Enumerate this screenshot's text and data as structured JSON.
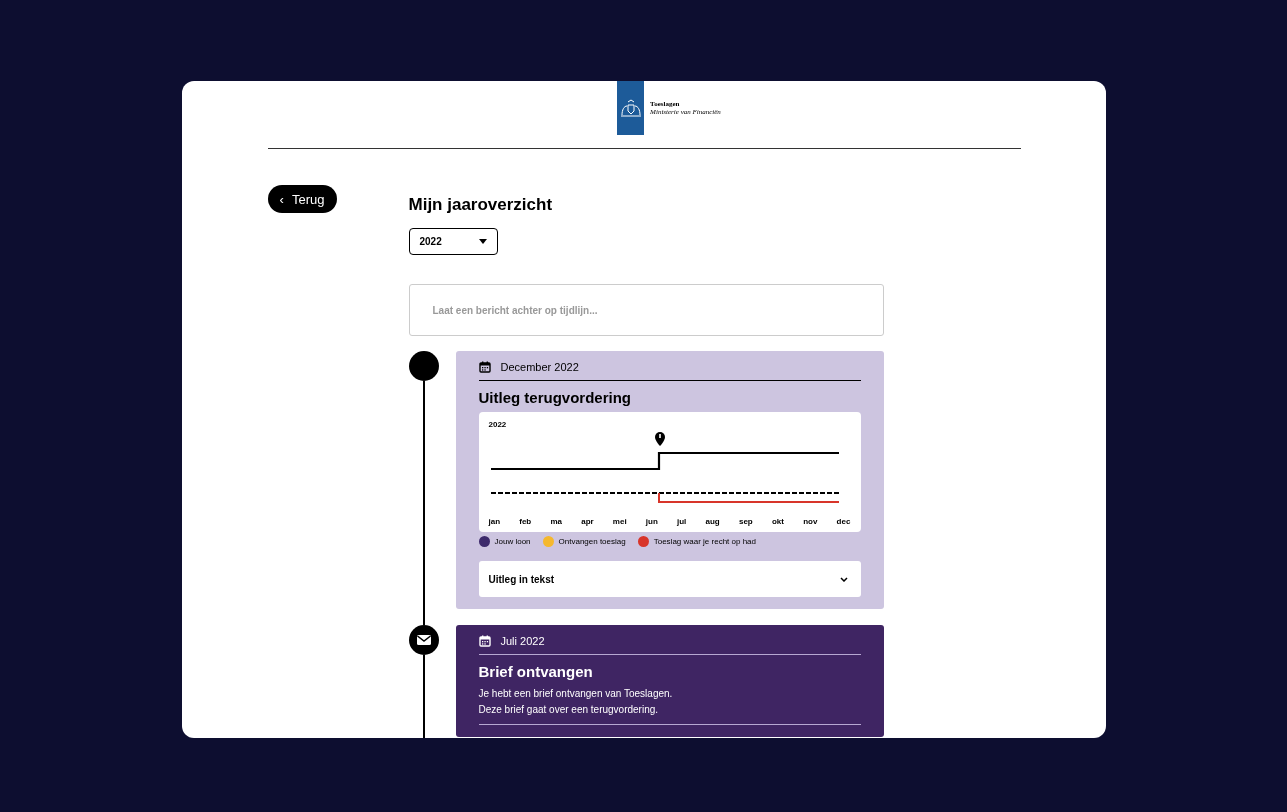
{
  "logo": {
    "name": "Toeslagen",
    "subtitle": "Ministerie van Financiën"
  },
  "back_button": {
    "label": "Terug",
    "icon": "‹"
  },
  "page": {
    "title": "Mijn jaaroverzicht",
    "year_select": {
      "value": "2022"
    }
  },
  "message_field": {
    "placeholder": "Laat een bericht achter op tijdlijn..."
  },
  "timeline": [
    {
      "kind": "chart",
      "date": "December 2022",
      "title": "Uitleg terugvordering",
      "chart_year": "2022",
      "months": [
        "jan",
        "feb",
        "ma",
        "apr",
        "mei",
        "jun",
        "jul",
        "aug",
        "sep",
        "okt",
        "nov",
        "dec"
      ],
      "legend": [
        {
          "label": "Jouw loon",
          "color": "#3d2a6b"
        },
        {
          "label": "Ontvangen toeslag",
          "color": "#f5b82e"
        },
        {
          "label": "Toeslag waar je recht op had",
          "color": "#d8352a"
        }
      ],
      "accordion": {
        "label": "Uitleg in tekst",
        "expanded": false
      }
    },
    {
      "kind": "letter",
      "date": "Juli 2022",
      "title": "Brief ontvangen",
      "lines": [
        "Je hebt een brief ontvangen van Toeslagen.",
        "Deze brief gaat over een terugvordering."
      ]
    }
  ]
}
